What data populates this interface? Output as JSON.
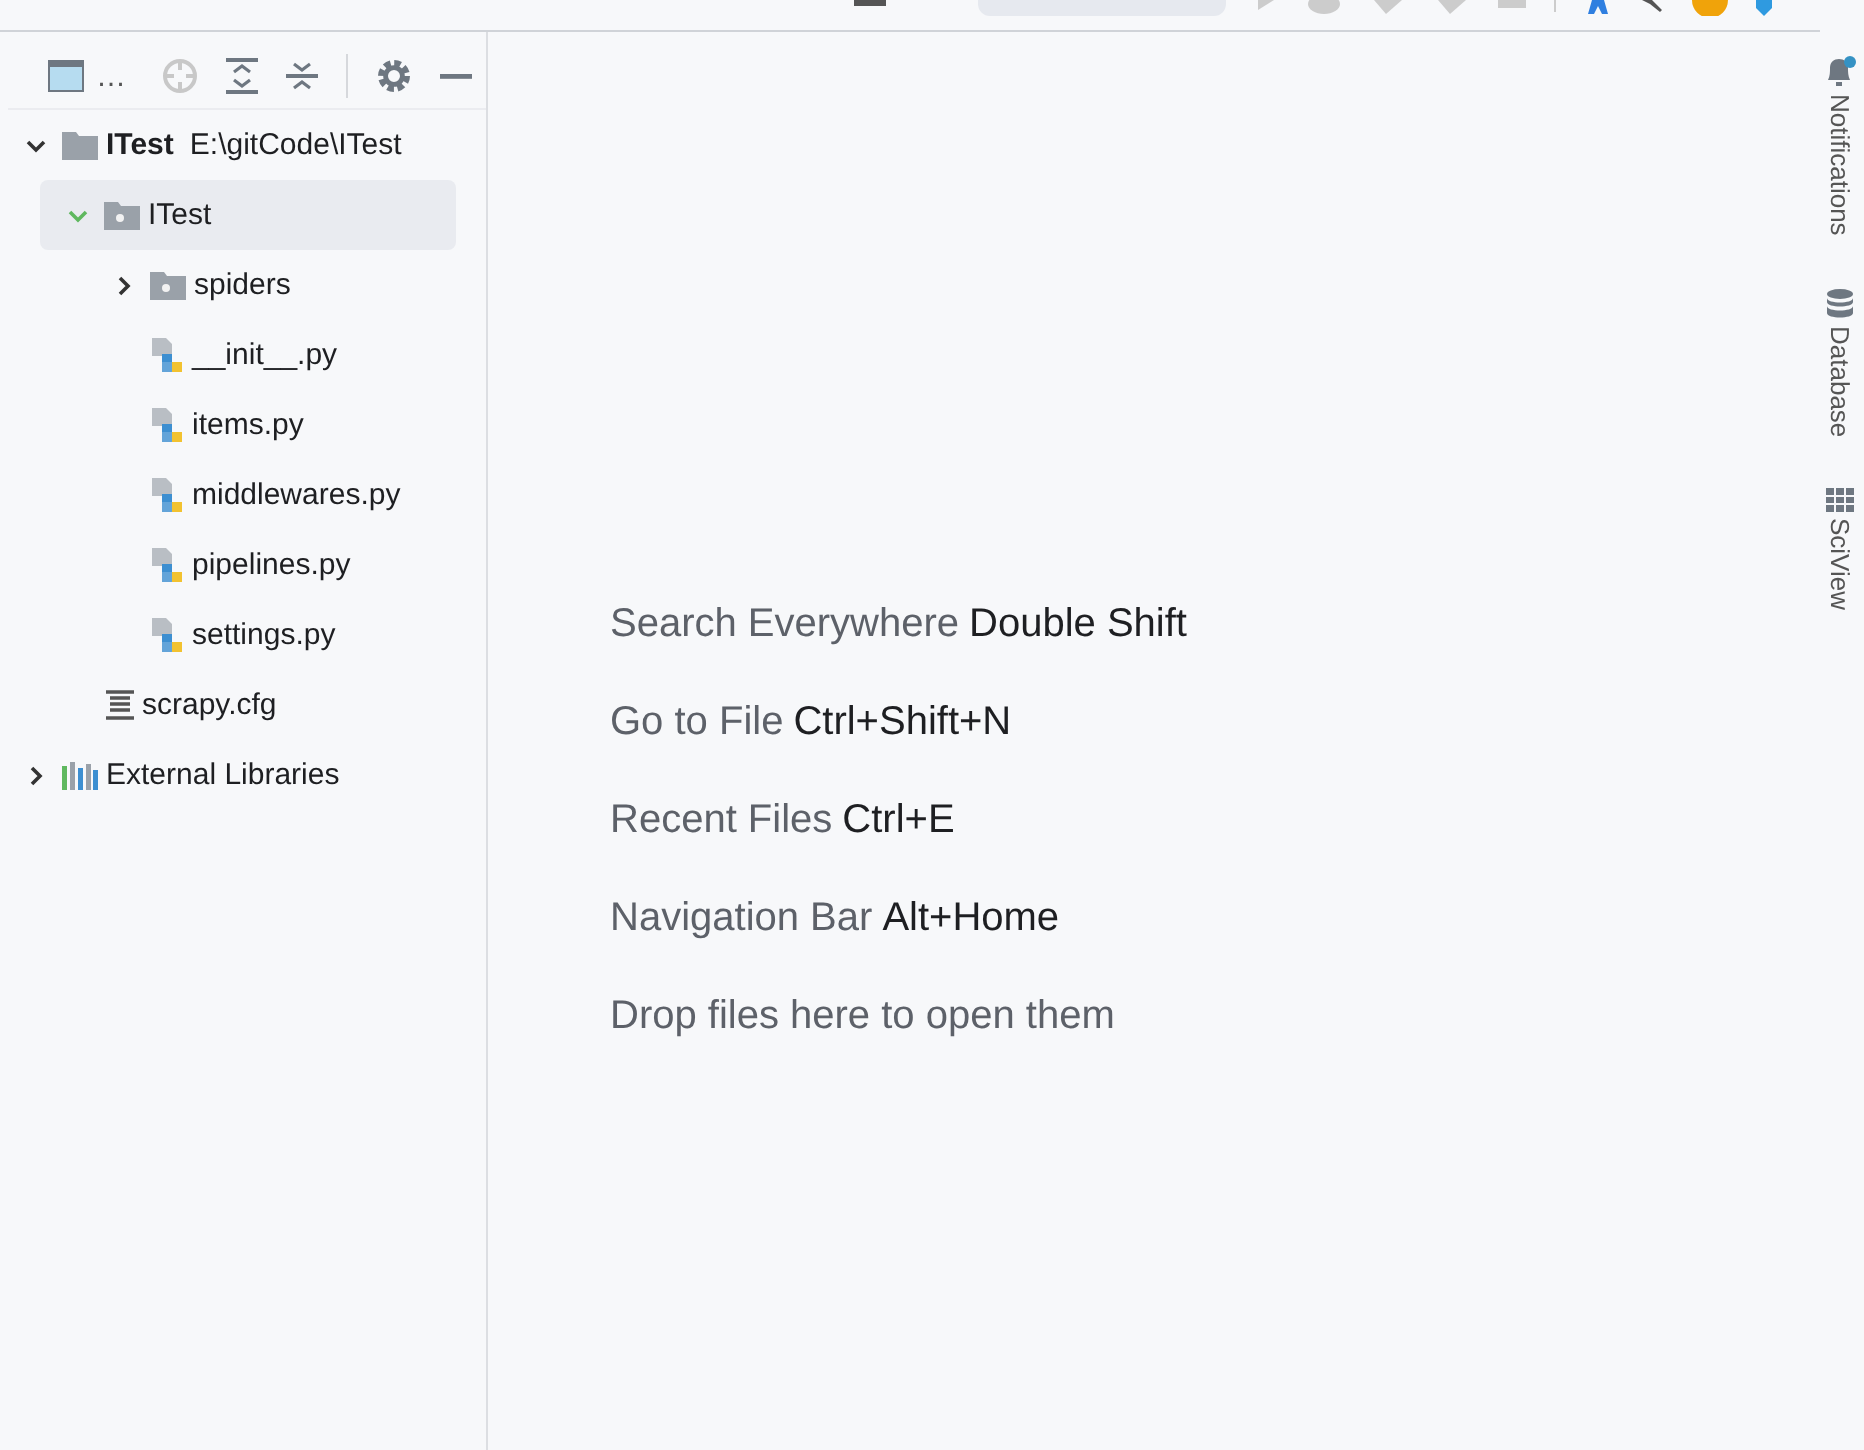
{
  "project_panel": {
    "title": "…",
    "tree": [
      {
        "label": "ITest",
        "detail": "E:\\gitCode\\ITest",
        "kind": "module",
        "expanded": true,
        "selected": false,
        "children": [
          {
            "label": "ITest",
            "kind": "package",
            "expanded": true,
            "selected": true,
            "children": [
              {
                "label": "spiders",
                "kind": "package",
                "expanded": false,
                "selected": false
              },
              {
                "label": "__init__.py",
                "kind": "python",
                "selected": false
              },
              {
                "label": "items.py",
                "kind": "python",
                "selected": false
              },
              {
                "label": "middlewares.py",
                "kind": "python",
                "selected": false
              },
              {
                "label": "pipelines.py",
                "kind": "python",
                "selected": false
              },
              {
                "label": "settings.py",
                "kind": "python",
                "selected": false
              }
            ]
          },
          {
            "label": "scrapy.cfg",
            "kind": "config",
            "selected": false
          }
        ]
      },
      {
        "label": "External Libraries",
        "kind": "libraries",
        "expanded": false,
        "selected": false
      }
    ]
  },
  "editor_hints": [
    {
      "action": "Search Everywhere",
      "shortcut": "Double Shift"
    },
    {
      "action": "Go to File",
      "shortcut": "Ctrl+Shift+N"
    },
    {
      "action": "Recent Files",
      "shortcut": "Ctrl+E"
    },
    {
      "action": "Navigation Bar",
      "shortcut": "Alt+Home"
    },
    {
      "action": "Drop files here to open them"
    }
  ],
  "right_toolbar": [
    {
      "label": "Notifications",
      "kind": "notifications"
    },
    {
      "label": "Database",
      "kind": "database"
    },
    {
      "label": "SciView",
      "kind": "sciview"
    }
  ]
}
